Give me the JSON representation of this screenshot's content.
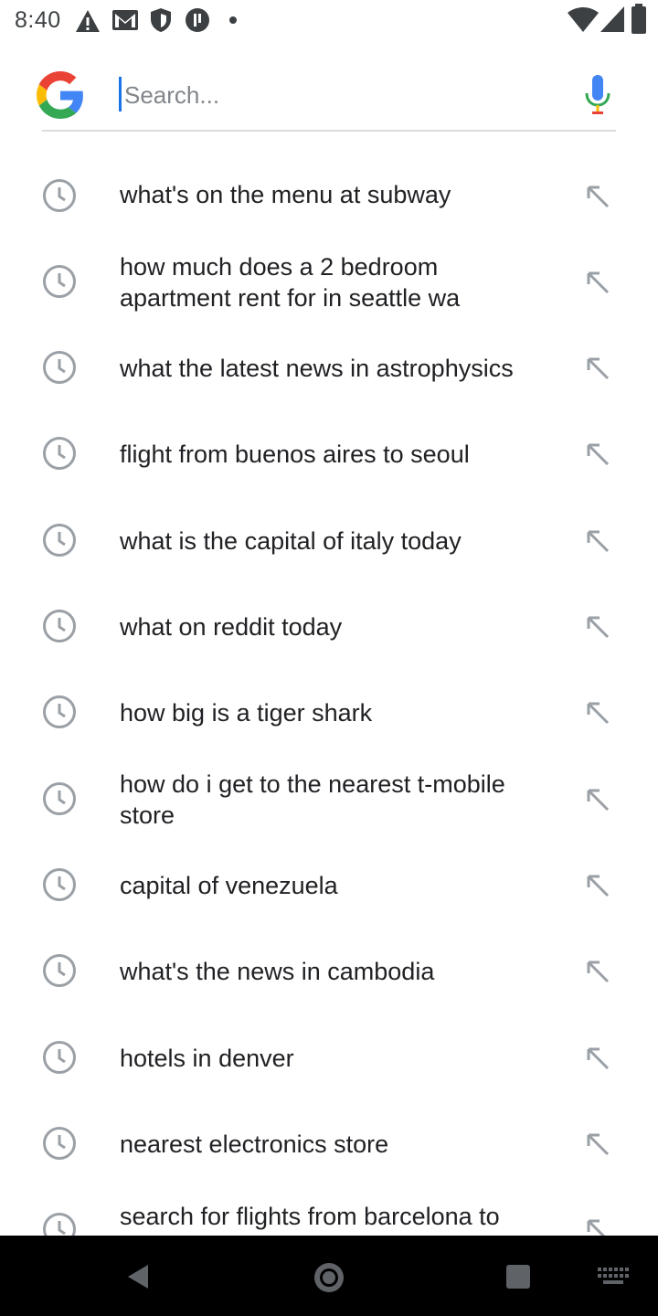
{
  "status_bar": {
    "time": "8:40",
    "left_icons": [
      "warning-icon",
      "gmail-icon",
      "shield-icon",
      "app-icon",
      "dot-icon"
    ],
    "right_icons": [
      "wifi-icon",
      "signal-icon",
      "battery-icon"
    ]
  },
  "search": {
    "placeholder": "Search...",
    "value": "",
    "logo": "google-g-icon",
    "mic": "mic-icon"
  },
  "suggestions": [
    {
      "text": "what's on the menu at subway"
    },
    {
      "text": "how much does a 2 bedroom apartment rent for in seattle wa"
    },
    {
      "text": "what the latest news in astrophysics"
    },
    {
      "text": "flight from buenos aires to seoul"
    },
    {
      "text": "what is the capital of italy today"
    },
    {
      "text": "what on reddit today"
    },
    {
      "text": "how big is a tiger shark"
    },
    {
      "text": "how do i get to the nearest t-mobile store"
    },
    {
      "text": "capital of venezuela"
    },
    {
      "text": "what's the news in cambodia"
    },
    {
      "text": "hotels in denver"
    },
    {
      "text": "nearest electronics store"
    },
    {
      "text": "search for flights from barcelona to"
    }
  ],
  "nav_bar": {
    "buttons": [
      "back-icon",
      "home-icon",
      "recents-icon",
      "keyboard-icon"
    ]
  },
  "colors": {
    "google_blue": "#4285F4",
    "google_red": "#EA4335",
    "google_yellow": "#FBBC05",
    "google_green": "#34A853",
    "icon_grey": "#9aa0a6",
    "text": "#202124"
  }
}
